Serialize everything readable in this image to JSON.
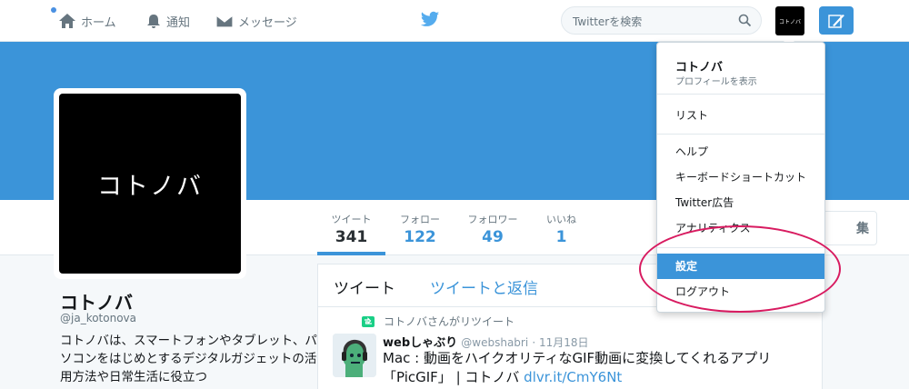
{
  "topbar": {
    "home_label": "ホーム",
    "notifications_label": "通知",
    "messages_label": "メッセージ",
    "search_placeholder": "Twitterを検索",
    "avatar_text": "コトノバ"
  },
  "profile": {
    "avatar_text": "コトノバ",
    "name": "コトノバ",
    "handle": "@ja_kotonova",
    "bio": "コトノバは、スマートフォンやタブレット、パソコンをはじめとするデジタルガジェットの活用方法や日常生活に役立つ"
  },
  "stats": [
    {
      "label": "ツイート",
      "value": "341"
    },
    {
      "label": "フォロー",
      "value": "122"
    },
    {
      "label": "フォロワー",
      "value": "49"
    },
    {
      "label": "いいね",
      "value": "1"
    }
  ],
  "edit_button": "集",
  "timeline": {
    "tabs": [
      "ツイート",
      "ツイートと返信"
    ],
    "retweet_line": "コトノバさんがリツイート",
    "tweet": {
      "author": "webしゃぶり",
      "handle": "@webshabri",
      "date": "· 11月18日",
      "text": "Mac : 動画をハイクオリティなGIF動画に変換してくれるアプリ「PicGIF」 | コトノバ ",
      "link": "dlvr.it/CmY6Nt"
    }
  },
  "dropdown": {
    "name": "コトノバ",
    "view_profile": "プロフィールを表示",
    "items": [
      "リスト",
      "ヘルプ",
      "キーボードショートカット",
      "Twitter広告",
      "アナリティクス",
      "設定",
      "ログアウト"
    ]
  },
  "colors": {
    "accent": "#3b94d9",
    "highlight": "#d81b60"
  }
}
